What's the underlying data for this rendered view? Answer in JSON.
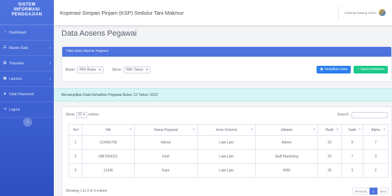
{
  "sidebar": {
    "brand": [
      "SISTEM",
      "INFORMASI",
      "PENGGAJIAN"
    ],
    "items": [
      {
        "label": "Dashboard",
        "icon": "dashboard-icon",
        "has_children": false
      },
      {
        "label": "Master Data",
        "icon": "database-icon",
        "has_children": true
      },
      {
        "label": "Transaksi",
        "icon": "transaction-icon",
        "has_children": true
      },
      {
        "label": "Laporan",
        "icon": "report-icon",
        "has_children": true
      },
      {
        "label": "Ubah Password",
        "icon": "lock-icon",
        "has_children": false
      },
      {
        "label": "Logout",
        "icon": "logout-icon",
        "has_children": false
      }
    ],
    "toggle_icon": "chevron-left-icon"
  },
  "topbar": {
    "title": "Koperasi Simpan Pinjam (KSP) Sedulur Tani Makmur",
    "user": "Selamat Datang Admin"
  },
  "page": {
    "title": "Data Aosens Pegawai"
  },
  "filter": {
    "header": "Filter Data Absensi Pegawai",
    "month_label": "Bulan",
    "month_value": "Pilih Bulan",
    "year_label": "Tahun",
    "year_value": "Pilih Tahun",
    "show_button": "Tampilkan Data",
    "add_button": "Input Kehadiran"
  },
  "notice": "Menampilkan Data Kehadiran Pegawai Bulan: 12 Tahun: 2023",
  "table": {
    "show_label": "Show",
    "entries_value": "10",
    "entries_label": "entries",
    "search_label": "Search:",
    "columns": [
      "No",
      "Nik",
      "Nama Pegawai",
      "Jenis Kelamin",
      "Jabatan",
      "Hadir",
      "Sakit",
      "Alpha"
    ],
    "rows": [
      [
        "1",
        "123456789",
        "Admin",
        "Laki-Laki",
        "Admin",
        "23",
        "0",
        "7"
      ],
      [
        "2",
        "0987654321",
        "Dedi",
        "Laki-Laki",
        "Staff Marketing",
        "23",
        "7",
        "3"
      ],
      [
        "3",
        "12345",
        "Karti",
        "Laki-Laki",
        "HRD",
        "25",
        "2",
        "2"
      ]
    ],
    "info": "Showing 1 to 3 of 3 entries",
    "prev": "Previous",
    "page": "1",
    "next": "Next"
  }
}
